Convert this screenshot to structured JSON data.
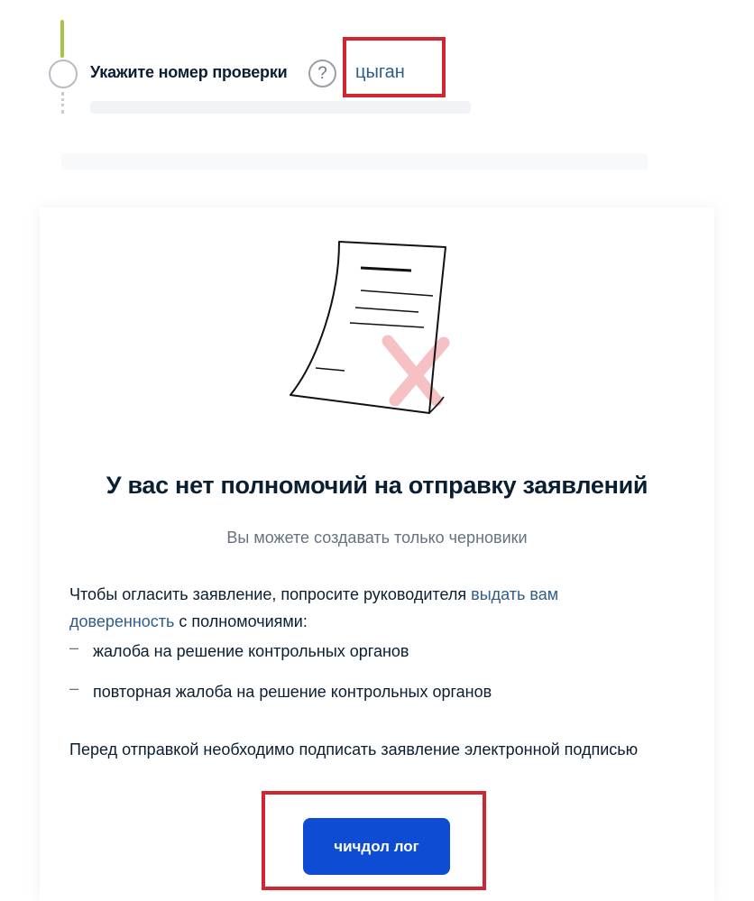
{
  "step": {
    "label": "Укажите номер проверки",
    "help_glyph": "?",
    "value": "цыган",
    "accent_color": "#a8c34a"
  },
  "card": {
    "title": "У вас нет полномочий на отправку заявлений",
    "subtitle": "Вы можете создавать только черновики",
    "instruction_prefix": "Чтобы огласить заявление, попросите руководителя ",
    "instruction_link": "выдать вам доверенность",
    "instruction_suffix": " с полномочиями:",
    "list_items": [
      "жалоба на решение контрольных органов",
      "повторная жалоба на решение контрольных органов"
    ],
    "signature_note": "Перед отправкой необходимо подписать заявление электронной подписью",
    "button_label": "чичдол лог",
    "button_color": "#0d4cd3",
    "link_color": "#2f5d8a"
  },
  "highlight_color": "#d0262f"
}
